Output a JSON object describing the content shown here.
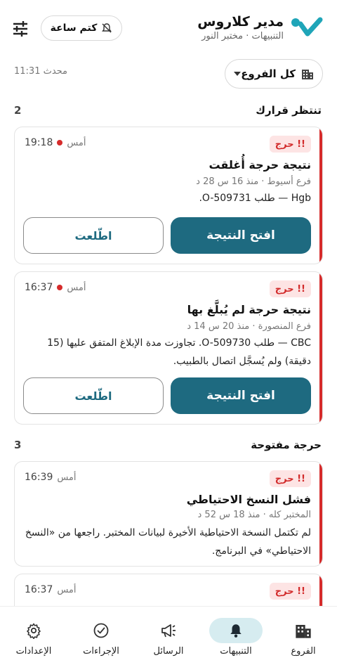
{
  "header": {
    "title": "مدير كلاروس",
    "subtitle": "التنبيهات · مختبر النور",
    "mute_label": "كتم ساعة"
  },
  "toolbar": {
    "updated": "محدث 11:31",
    "branch_select": "كل الفروع"
  },
  "sections": {
    "awaiting": {
      "title": "تنتظر قرارك",
      "count": "2"
    },
    "open": {
      "title": "حرجة مفتوحة",
      "count": "3"
    }
  },
  "cards": [
    {
      "badge": "!! حرج",
      "day": "أمس",
      "time": "19:18",
      "title": "نتيجة حرجة أُغلقت",
      "meta": "فرع أسيوط · منذ 16 س 28 د",
      "body": "Hgb — طلب O-509731.",
      "primary": "افتح النتيجة",
      "secondary": "اطّلعت"
    },
    {
      "badge": "!! حرج",
      "day": "أمس",
      "time": "16:37",
      "title": "نتيجة حرجة لم يُبلَّغ بها",
      "meta": "فرع المنصورة · منذ 20 س 14 د",
      "body": "CBC — طلب O-509730. تجاوزت مدة الإبلاغ المتفق عليها (15 دقيقة) ولم يُسجَّل اتصال بالطبيب.",
      "primary": "افتح النتيجة",
      "secondary": "اطّلعت"
    },
    {
      "badge": "!! حرج",
      "day": "أمس",
      "time": "16:39",
      "title": "فشل النسخ الاحتياطي",
      "meta": "المختبر كله · منذ 18 س 52 د",
      "body": "لم تكتمل النسخة الاحتياطية الأخيرة لبيانات المختبر. راجعها من «النسخ الاحتياطي» في البرنامج."
    },
    {
      "badge": "!! حرج",
      "day": "أمس",
      "time": "16:37"
    }
  ],
  "nav": [
    {
      "label": "الفروع",
      "icon": "building-icon"
    },
    {
      "label": "التنبيهات",
      "icon": "bell-icon",
      "active": true
    },
    {
      "label": "الرسائل",
      "icon": "megaphone-icon"
    },
    {
      "label": "الإجراءات",
      "icon": "check-circle-icon"
    },
    {
      "label": "الإعدادات",
      "icon": "gear-icon"
    }
  ],
  "colors": {
    "primary": "#1e6a80",
    "critical": "#d62b2b",
    "badge_bg": "#fde4e4",
    "nav_active": "#d6ecf0"
  }
}
